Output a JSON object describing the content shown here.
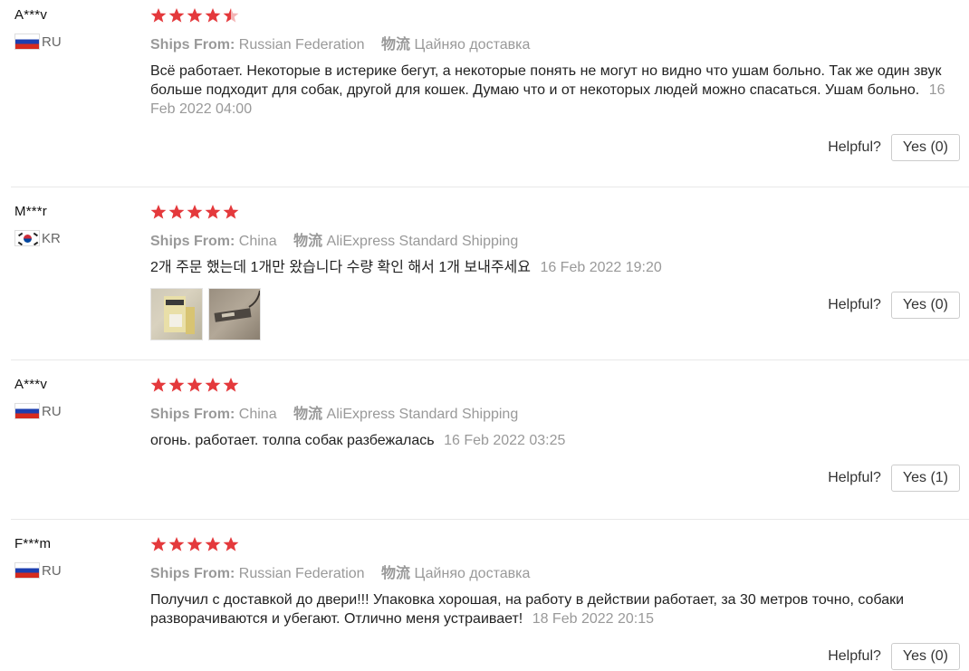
{
  "colors": {
    "star": "#e4393c",
    "muted": "#999999",
    "divider": "#e8e8e8"
  },
  "labels": {
    "ships_from": "Ships From:",
    "shipping": "物流",
    "helpful": "Helpful?"
  },
  "reviews": [
    {
      "user": "A***v",
      "country": "RU",
      "flag_icon": "russia-flag-icon",
      "rating": 4.5,
      "ships_from": "Russian Federation",
      "shipping": "Цайняо доставка",
      "text": "Всё работает. Некоторые в истерике бегут, а некоторые понять не могут но видно что ушам больно. Так же один звук больше подходит для собак, другой для кошек. Думаю что и от некоторых людей можно спасаться. Ушам больно.",
      "date": "16 Feb 2022 04:00",
      "helpful_button": "Yes (0)"
    },
    {
      "user": "M***r",
      "country": "KR",
      "flag_icon": "south-korea-flag-icon",
      "rating": 5,
      "ships_from": "China",
      "shipping": "AliExpress Standard Shipping",
      "text": "2개 주문 했는데 1개만 왔습니다 수량 확인 해서 1개 보내주세요",
      "date": "16 Feb 2022 19:20",
      "helpful_button": "Yes (0)",
      "photos": [
        "review-photo-1",
        "review-photo-2"
      ]
    },
    {
      "user": "A***v",
      "country": "RU",
      "flag_icon": "russia-flag-icon",
      "rating": 5,
      "ships_from": "China",
      "shipping": "AliExpress Standard Shipping",
      "text": "огонь. работает. толпа собак разбежалась",
      "date": "16 Feb 2022 03:25",
      "helpful_button": "Yes (1)"
    },
    {
      "user": "F***m",
      "country": "RU",
      "flag_icon": "russia-flag-icon",
      "rating": 5,
      "ships_from": "Russian Federation",
      "shipping": "Цайняо доставка",
      "text": "Получил с доставкой до двери!!! Упаковка хорошая, на работу в действии работает, за 30 метров точно, собаки разворачиваются и убегают. Отлично меня устраивает!",
      "date": "18 Feb 2022 20:15",
      "helpful_button": "Yes (0)"
    }
  ]
}
